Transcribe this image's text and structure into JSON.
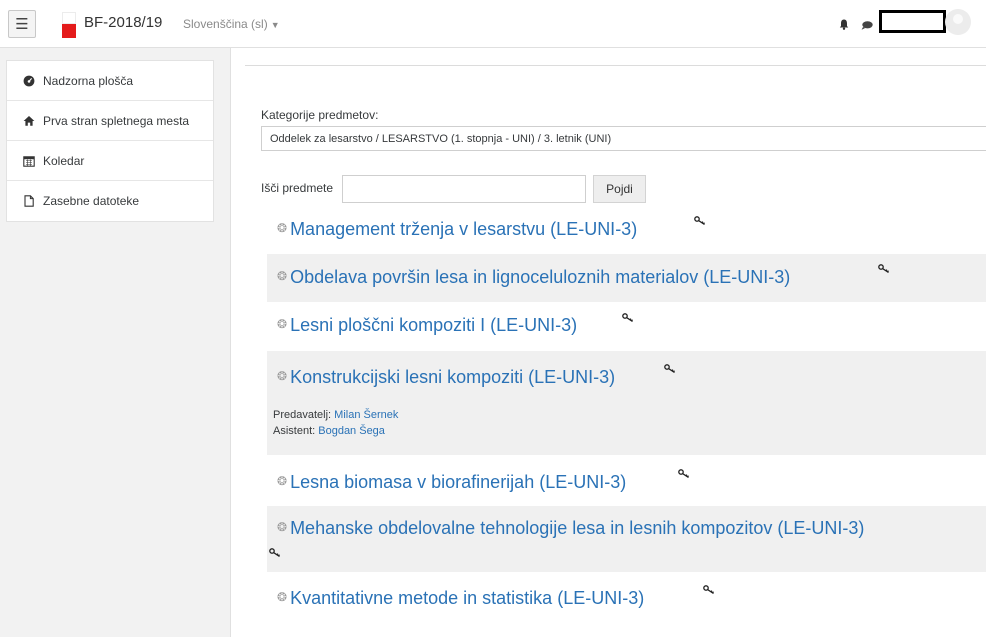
{
  "navbar": {
    "site_name": "BF-2018/19",
    "language": "Slovenščina (sl)",
    "menu_icon": "hamburger-icon",
    "notification_icon": "bell-icon",
    "message_icon": "chat-icon"
  },
  "sidebar": {
    "items": [
      {
        "label": "Nadzorna plošča",
        "icon": "dashboard-icon"
      },
      {
        "label": "Prva stran spletnega mesta",
        "icon": "home-icon"
      },
      {
        "label": "Koledar",
        "icon": "calendar-icon"
      },
      {
        "label": "Zasebne datoteke",
        "icon": "file-icon"
      }
    ]
  },
  "category": {
    "label": "Kategorije predmetov:",
    "selected": "Oddelek za lesarstvo / LESARSTVO (1. stopnja - UNI) / 3. letnik (UNI)"
  },
  "search": {
    "label": "Išči predmete",
    "value": "",
    "button": "Pojdi"
  },
  "courses": [
    {
      "title": "Management trženja v lesarstvu (LE-UNI-3)"
    },
    {
      "title": "Obdelava površin lesa in lignoceluloznih materialov (LE-UNI-3)"
    },
    {
      "title": "Lesni ploščni kompoziti I (LE-UNI-3)"
    },
    {
      "title": "Konstrukcijski lesni kompoziti (LE-UNI-3)",
      "teacher_role": "Predavatelj:",
      "teacher_name": "Milan Šernek",
      "assistant_role": "Asistent:",
      "assistant_name": "Bogdan Šega"
    },
    {
      "title": "Lesna biomasa v biorafinerijah (LE-UNI-3)"
    },
    {
      "title": "Mehanske obdelovalne tehnologije lesa in lesnih kompozitov (LE-UNI-3)"
    },
    {
      "title": "Kvantitativne metode in statistika (LE-UNI-3)"
    }
  ],
  "colors": {
    "link": "#2a72b6",
    "brand_red": "#e41b1b",
    "alt_row": "#f0f0f0"
  }
}
